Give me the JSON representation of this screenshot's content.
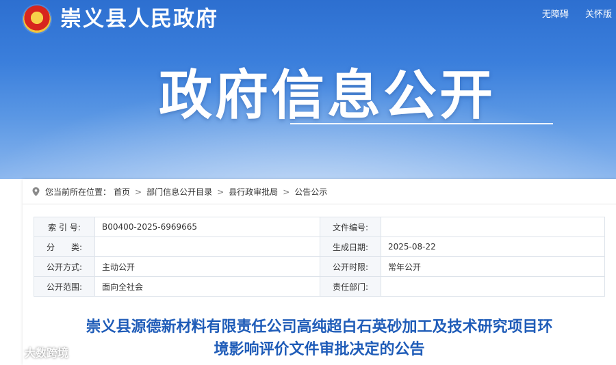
{
  "header": {
    "site_title": "崇义县人民政府",
    "links": [
      "无障碍",
      "关怀版"
    ]
  },
  "hero": {
    "title": "政府信息公开"
  },
  "breadcrumb": {
    "prefix": "您当前所在位置：",
    "items": [
      "首页",
      "部门信息公开目录",
      "县行政审批局",
      "公告公示"
    ]
  },
  "meta": {
    "rows": [
      {
        "k1": "索 引 号:",
        "v1": "B00400-2025-6969665",
        "k2": "文件编号:",
        "v2": ""
      },
      {
        "k1": "分　　类:",
        "v1": "",
        "k2": "生成日期:",
        "v2": "2025-08-22"
      },
      {
        "k1": "公开方式:",
        "v1": "主动公开",
        "k2": "公开时限:",
        "v2": "常年公开"
      },
      {
        "k1": "公开范围:",
        "v1": "面向全社会",
        "k2": "责任部门:",
        "v2": ""
      }
    ]
  },
  "article": {
    "title_line1": "崇义县源德新材料有限责任公司高纯超白石英砂加工及技术研究项目环",
    "title_line2": "境影响评价文件审批决定的公告"
  },
  "watermark": {
    "text": "大数跨境"
  },
  "colors": {
    "banner": "#3b7fdc",
    "title_blue": "#1f5cb8"
  }
}
